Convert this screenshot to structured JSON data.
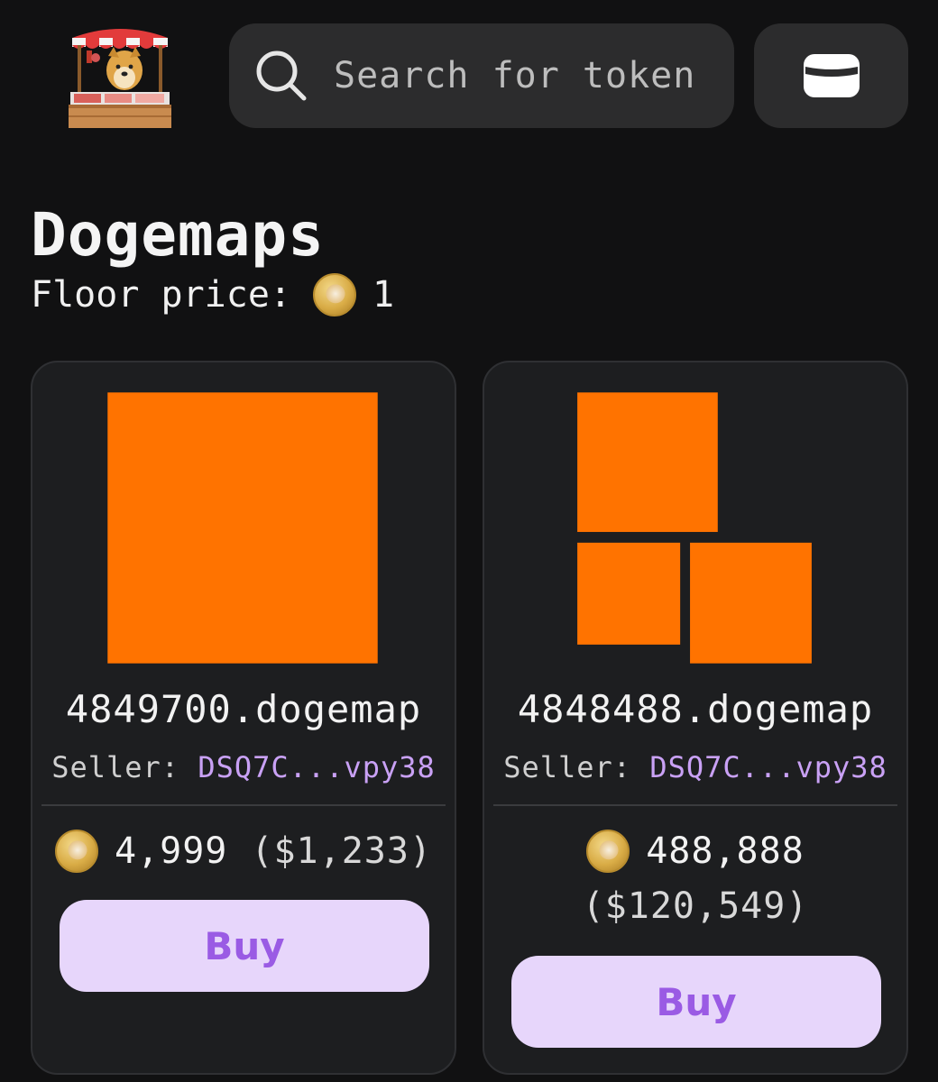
{
  "header": {
    "logo_name": "doge-market-stall",
    "search_placeholder": "Search for token",
    "search_icon": "search-icon",
    "wallet_icon": "wallet-icon"
  },
  "collection": {
    "title": "Dogemaps",
    "floor_label": "Floor price:",
    "floor_value": "1"
  },
  "listings": [
    {
      "name": "4849700.dogemap",
      "seller_label": "Seller:",
      "seller_address": "DSQ7C...vpy38",
      "price": "4,999",
      "usd": "($1,233)",
      "buy_label": "Buy"
    },
    {
      "name": "4848488.dogemap",
      "seller_label": "Seller:",
      "seller_address": "DSQ7C...vpy38",
      "price": "488,888",
      "usd": "($120,549)",
      "buy_label": "Buy"
    }
  ],
  "colors": {
    "background": "#111112",
    "card": "#1d1e20",
    "accent_orange": "#ff7300",
    "buy_bg": "#e7d6fb",
    "buy_text": "#9a5be4",
    "address": "#c9a1f5"
  }
}
